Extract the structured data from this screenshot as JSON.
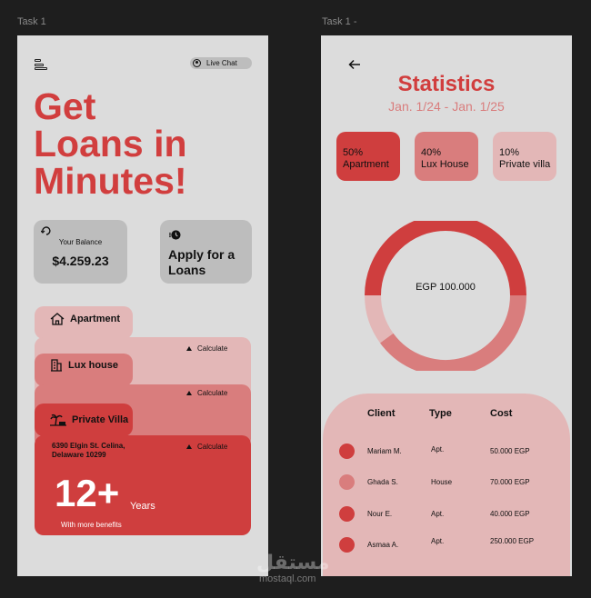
{
  "frames": {
    "left_label": "Task 1",
    "right_label": "Task 1 -"
  },
  "screen1": {
    "live_chat": "Live Chat",
    "hero_lines": [
      "Get",
      "Loans in",
      "Minutes!"
    ],
    "balance_label": "Your Balance",
    "balance_value": "$4.259.23",
    "apply_lines": [
      "Apply for a",
      "Loans"
    ],
    "tabs": [
      {
        "title": "Apartment",
        "calc": "Calculate",
        "color": "#e3b7b7"
      },
      {
        "title": "Lux house",
        "calc": "Calculate",
        "color": "#d97d7d"
      },
      {
        "title": "Private Villa",
        "calc": "Calculate",
        "color": "#cf3e3e"
      }
    ],
    "address_lines": [
      "6390 Elgin St. Celina,",
      "Delaware 10299"
    ],
    "years_num": "12+",
    "years_word": "Years",
    "benefits": "With more benefits"
  },
  "screen2": {
    "title": "Statistics",
    "range": "Jan. 1/24 - Jan. 1/25",
    "pills": [
      {
        "pct": "50%",
        "label": "Apartment"
      },
      {
        "pct": "40%",
        "label": "Lux House"
      },
      {
        "pct": "10%",
        "label": "Private villa"
      }
    ],
    "donut_label": "EGP 100.000",
    "donut_segments": [
      {
        "share": 0.5,
        "color": "#cf3e3e"
      },
      {
        "share": 0.4,
        "color": "#d97d7d"
      },
      {
        "share": 0.1,
        "color": "#e3b7b7"
      }
    ],
    "table": {
      "headers": [
        "Client",
        "Type",
        "Cost"
      ],
      "rows": [
        {
          "client": "Mariam M.",
          "type": "Apt.",
          "cost": "50.000 EGP",
          "color": "#cf3e3e"
        },
        {
          "client": "Ghada S.",
          "type": "House",
          "cost": "70.000 EGP",
          "color": "#d97d7d"
        },
        {
          "client": "Nour E.",
          "type": "Apt.",
          "cost": "40.000 EGP",
          "color": "#cf3e3e"
        },
        {
          "client": "Asmaa A.",
          "type": "Apt.",
          "cost": "250.000 EGP",
          "color": "#cf3e3e"
        }
      ]
    }
  },
  "watermark": {
    "arabic": "مستقل",
    "latin": "mostaql.com"
  },
  "colors": {
    "accent": "#d13e3e",
    "mid": "#d97d7d",
    "light": "#e3b7b7",
    "screen_bg": "#dcdcdc"
  }
}
